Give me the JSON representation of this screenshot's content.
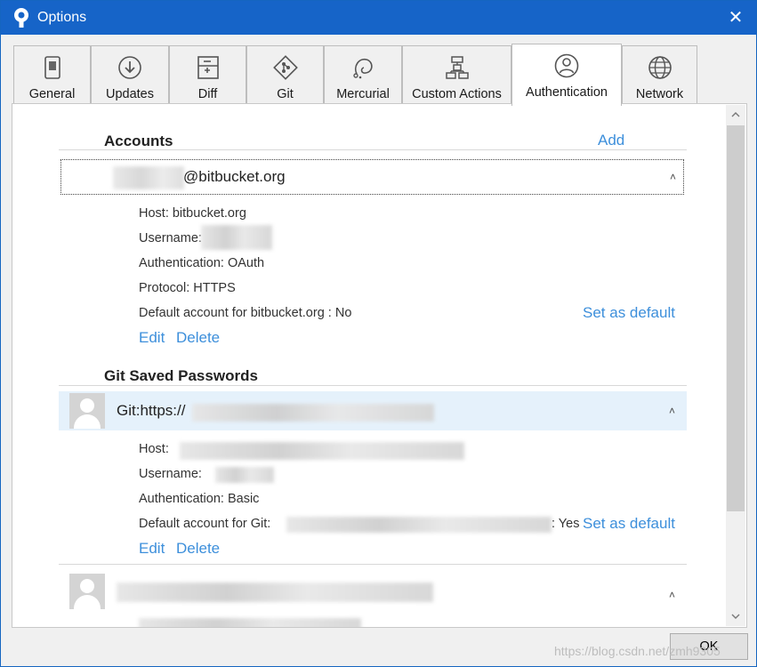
{
  "window": {
    "title": "Options",
    "close_glyph": "✕"
  },
  "tabs": [
    {
      "label": "General",
      "icon": "switch-icon"
    },
    {
      "label": "Updates",
      "icon": "download-icon"
    },
    {
      "label": "Diff",
      "icon": "diff-icon"
    },
    {
      "label": "Git",
      "icon": "git-icon"
    },
    {
      "label": "Mercurial",
      "icon": "mercurial-icon"
    },
    {
      "label": "Custom Actions",
      "icon": "custom-actions-icon"
    },
    {
      "label": "Authentication",
      "icon": "user-icon",
      "active": true
    },
    {
      "label": "Network",
      "icon": "globe-icon"
    }
  ],
  "accounts": {
    "heading": "Accounts",
    "add_label": "Add",
    "account": {
      "name_suffix": "@bitbucket.org",
      "host": "Host:  bitbucket.org",
      "username": "Username:",
      "authentication": "Authentication:  OAuth",
      "protocol": "Protocol:  HTTPS",
      "default_account": "Default account for bitbucket.org :  No",
      "set_default": "Set as default",
      "edit": "Edit",
      "delete": "Delete"
    }
  },
  "git_passwords": {
    "heading": "Git Saved Passwords",
    "entry": {
      "name_prefix": "Git:https://",
      "host": "Host:",
      "username": "Username:",
      "authentication": "Authentication:  Basic",
      "default_prefix": "Default account for Git:",
      "default_value": ":  Yes",
      "set_default": "Set as default",
      "edit": "Edit",
      "delete": "Delete"
    }
  },
  "buttons": {
    "ok": "OK"
  },
  "watermark": "https://blog.csdn.net/zmh9305",
  "colors": {
    "titlebar": "#1664c8",
    "link": "#3d8fdb",
    "selected_row": "#e5f1fb"
  }
}
